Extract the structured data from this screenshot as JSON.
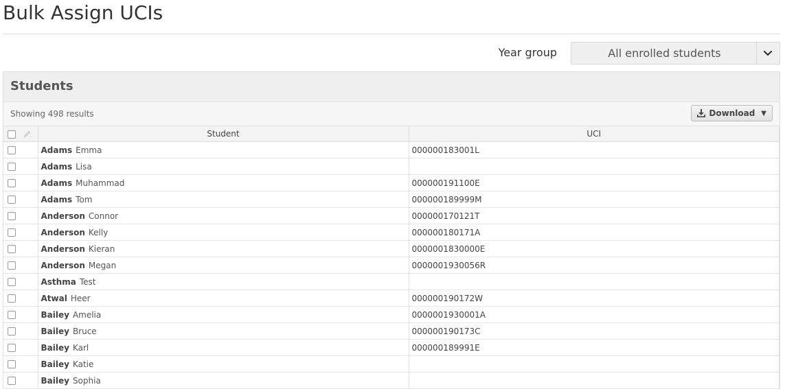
{
  "page": {
    "title": "Bulk Assign UCIs"
  },
  "filter": {
    "label": "Year group",
    "selected": "All enrolled students"
  },
  "panel": {
    "title": "Students",
    "results_text": "Showing 498 results",
    "download_label": "Download"
  },
  "table": {
    "columns": {
      "student": "Student",
      "uci": "UCI"
    },
    "rows": [
      {
        "surname": "Adams",
        "forename": "Emma",
        "uci": "000000183001L"
      },
      {
        "surname": "Adams",
        "forename": "Lisa",
        "uci": ""
      },
      {
        "surname": "Adams",
        "forename": "Muhammad",
        "uci": "000000191100E"
      },
      {
        "surname": "Adams",
        "forename": "Tom",
        "uci": "000000189999M"
      },
      {
        "surname": "Anderson",
        "forename": "Connor",
        "uci": "000000170121T"
      },
      {
        "surname": "Anderson",
        "forename": "Kelly",
        "uci": "000000180171A"
      },
      {
        "surname": "Anderson",
        "forename": "Kieran",
        "uci": "0000001830000E"
      },
      {
        "surname": "Anderson",
        "forename": "Megan",
        "uci": "0000001930056R"
      },
      {
        "surname": "Asthma",
        "forename": "Test",
        "uci": ""
      },
      {
        "surname": "Atwal",
        "forename": "Heer",
        "uci": "000000190172W"
      },
      {
        "surname": "Bailey",
        "forename": "Amelia",
        "uci": "0000001930001A"
      },
      {
        "surname": "Bailey",
        "forename": "Bruce",
        "uci": "000000190173C"
      },
      {
        "surname": "Bailey",
        "forename": "Karl",
        "uci": "000000189991E"
      },
      {
        "surname": "Bailey",
        "forename": "Katie",
        "uci": ""
      },
      {
        "surname": "Bailey",
        "forename": "Sophia",
        "uci": ""
      }
    ]
  },
  "icons": {
    "select_arrow": "chevron-down-icon",
    "download": "download-icon",
    "download_caret": "caret-down-icon",
    "bulk_edit": "pencil-icon"
  }
}
